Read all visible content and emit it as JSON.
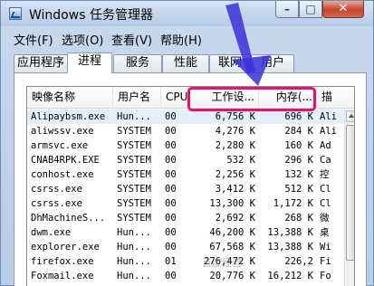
{
  "window": {
    "title": "Windows 任务管理器"
  },
  "controls": {
    "minimize": "–",
    "maximize": "□",
    "close": "✕"
  },
  "menu": [
    "文件(F)",
    "选项(O)",
    "查看(V)",
    "帮助(H)"
  ],
  "tabs": [
    {
      "label": "应用程序",
      "active": false
    },
    {
      "label": "进程",
      "active": true
    },
    {
      "label": "服务",
      "active": false
    },
    {
      "label": "性能",
      "active": false
    },
    {
      "label": "联网",
      "active": false
    },
    {
      "label": "用户",
      "active": false
    }
  ],
  "columns": [
    "映像名称",
    "用户名",
    "CPU",
    "工作设...",
    "内存(...",
    "描"
  ],
  "rows": [
    {
      "name": "Alipaybsm.exe",
      "user": "Hun...",
      "cpu": "00",
      "ws": "6,756 K",
      "mem": "696 K",
      "desc": "Ali"
    },
    {
      "name": "aliwssv.exe",
      "user": "SYSTEM",
      "cpu": "00",
      "ws": "4,276 K",
      "mem": "284 K",
      "desc": "Ali"
    },
    {
      "name": "armsvc.exe",
      "user": "SYSTEM",
      "cpu": "00",
      "ws": "2,280 K",
      "mem": "160 K",
      "desc": "Ad"
    },
    {
      "name": "CNAB4RPK.EXE",
      "user": "SYSTEM",
      "cpu": "00",
      "ws": "532 K",
      "mem": "296 K",
      "desc": "Ca"
    },
    {
      "name": "conhost.exe",
      "user": "SYSTEM",
      "cpu": "00",
      "ws": "2,256 K",
      "mem": "132 K",
      "desc": "控"
    },
    {
      "name": "csrss.exe",
      "user": "SYSTEM",
      "cpu": "00",
      "ws": "3,412 K",
      "mem": "512 K",
      "desc": "Cl"
    },
    {
      "name": "csrss.exe",
      "user": "SYSTEM",
      "cpu": "00",
      "ws": "13,300 K",
      "mem": "1,172 K",
      "desc": "Cl"
    },
    {
      "name": "DhMachineS...",
      "user": "SYSTEM",
      "cpu": "00",
      "ws": "2,692 K",
      "mem": "268 K",
      "desc": "微"
    },
    {
      "name": "dwm.exe",
      "user": "Hun...",
      "cpu": "00",
      "ws": "46,200 K",
      "mem": "13,388 K",
      "desc": "桌"
    },
    {
      "name": "explorer.exe",
      "user": "Hun...",
      "cpu": "00",
      "ws": "67,568 K",
      "mem": "13,388 K",
      "desc": "Wi"
    },
    {
      "name": "firefox.exe",
      "user": "Hun...",
      "cpu": "01",
      "ws": "276,472 K",
      "mem": "226,2",
      "desc": "Fi"
    },
    {
      "name": "Foxmail.exe",
      "user": "Hun...",
      "cpu": "00",
      "ws": "20,776 K",
      "mem": "16,212 K",
      "desc": "Fo"
    }
  ],
  "colors": {
    "highlight": "#e8126e",
    "arrow": "#3b2fd8"
  }
}
